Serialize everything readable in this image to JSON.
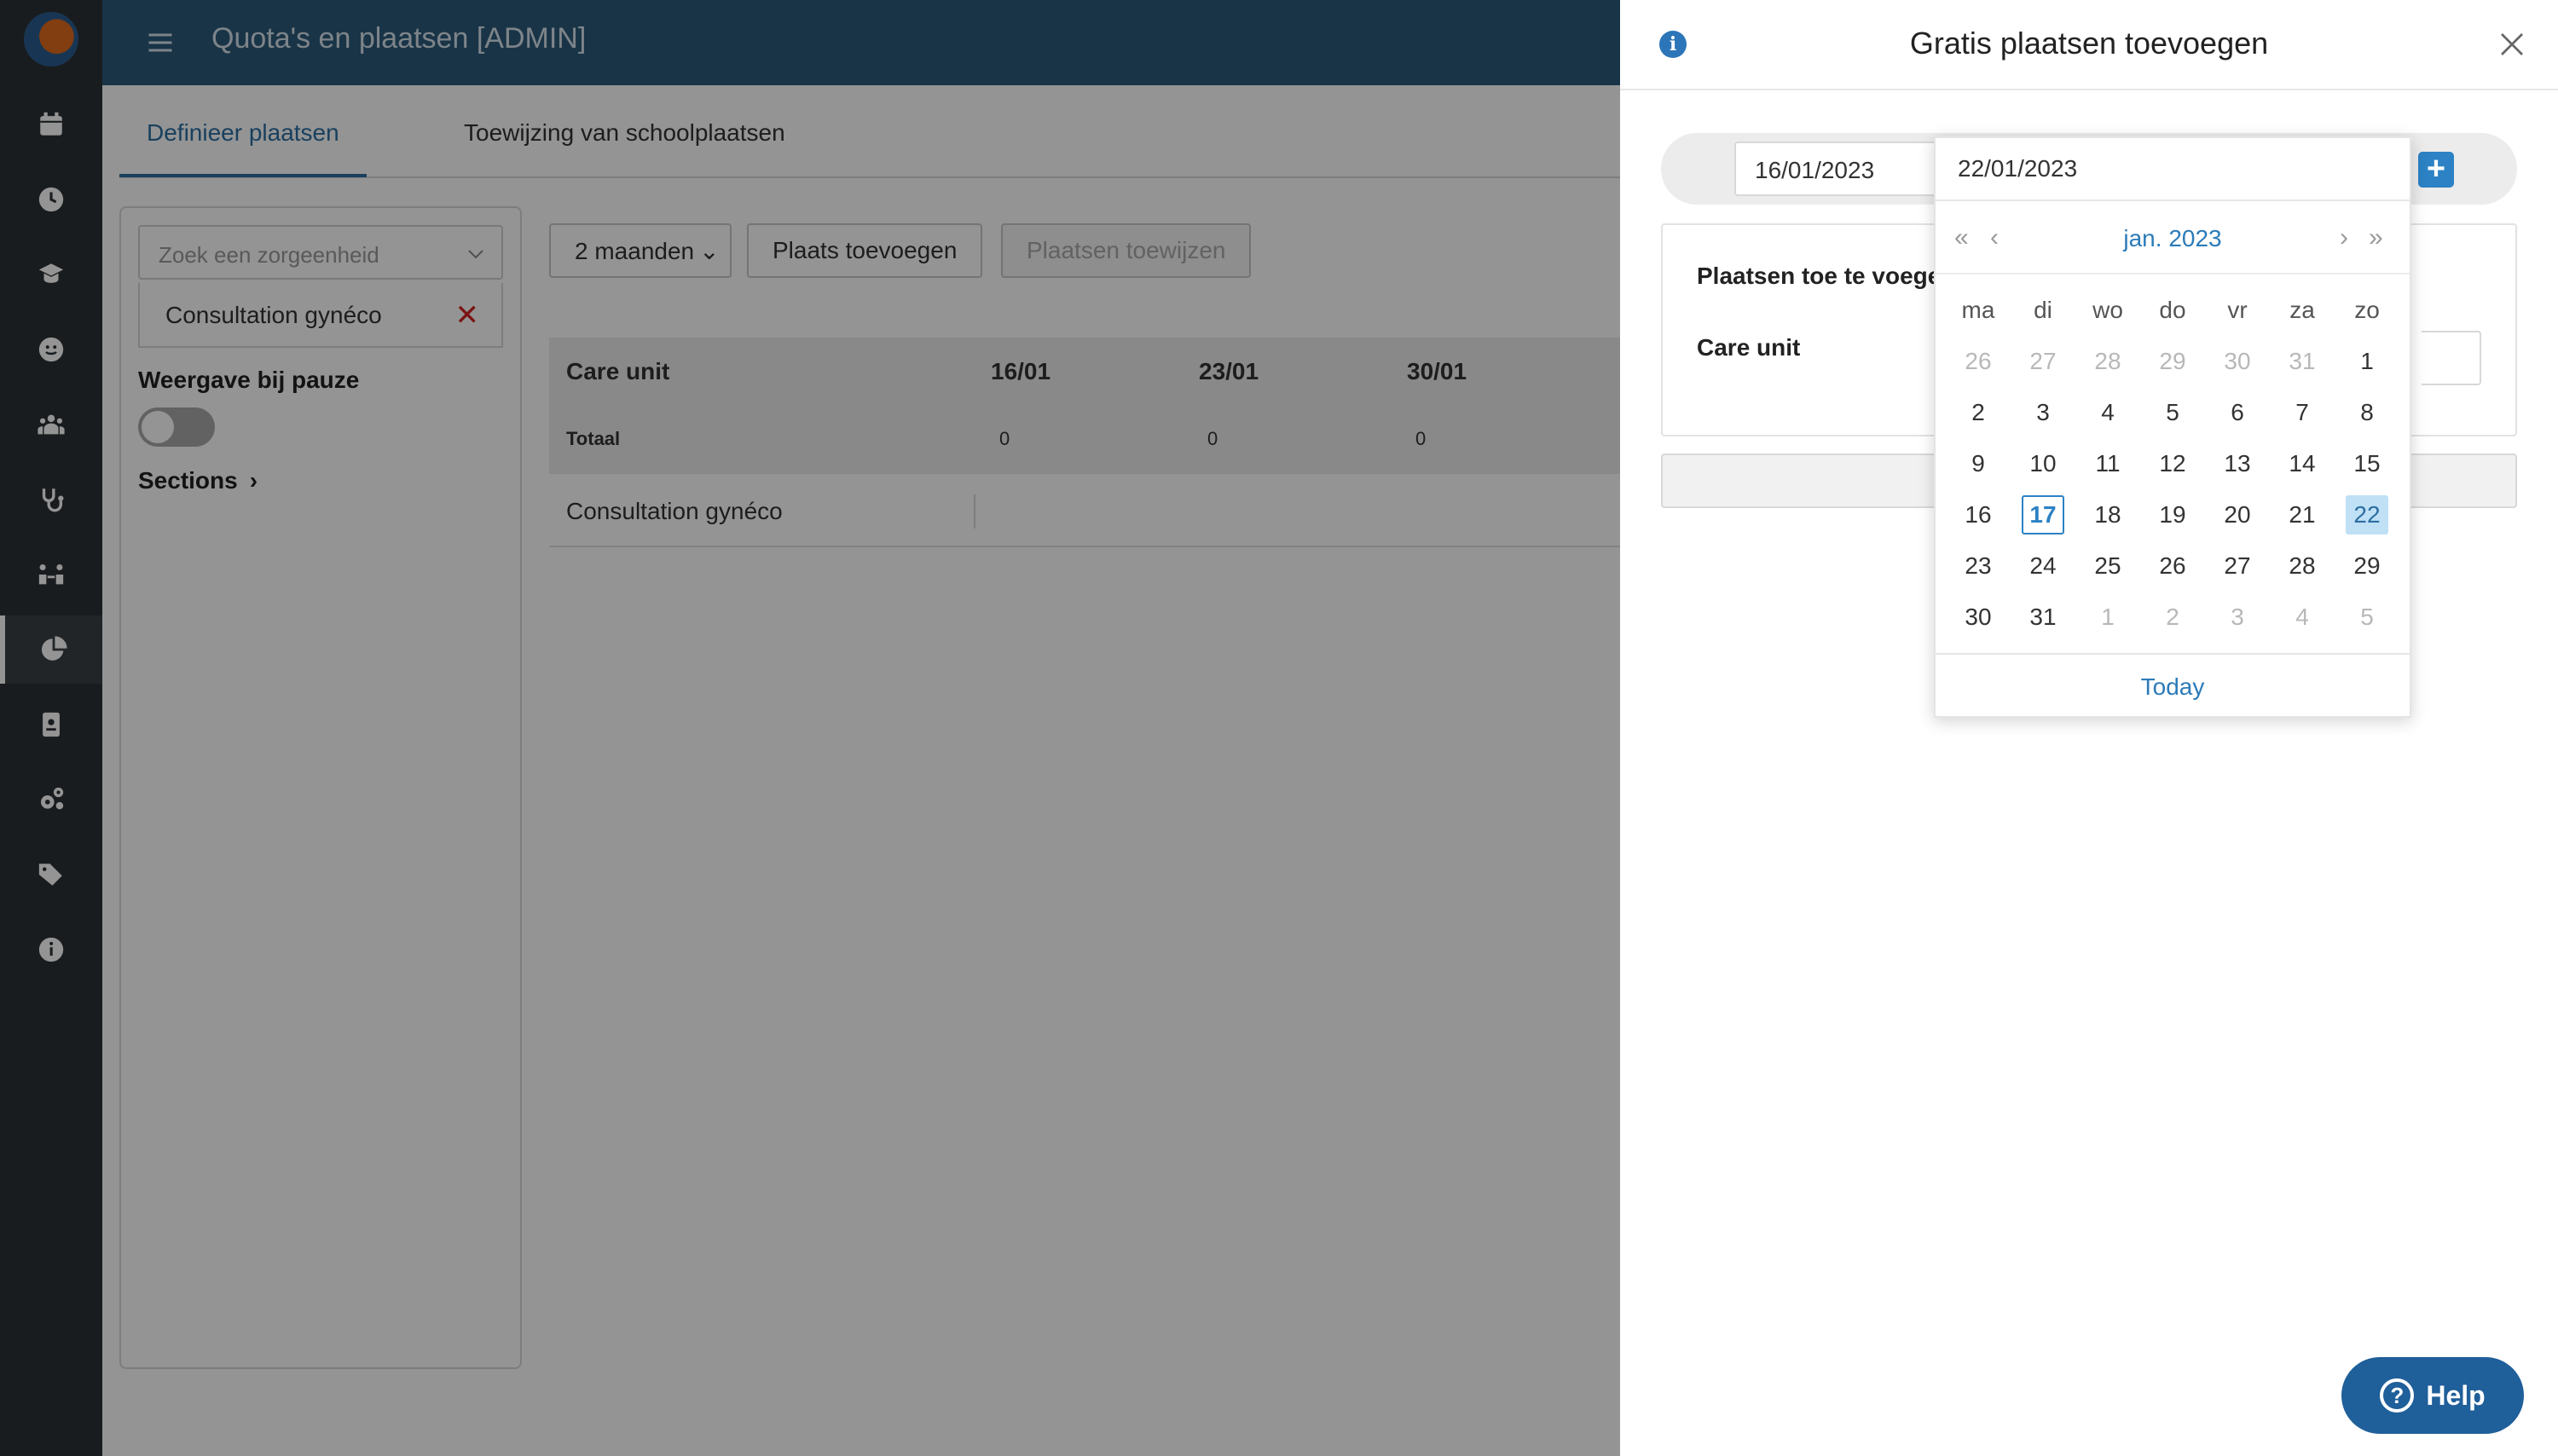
{
  "header": {
    "title": "Quota's en plaatsen [ADMIN]"
  },
  "tabs": [
    {
      "label": "Definieer plaatsen"
    },
    {
      "label": "Toewijzing van schoolplaatsen"
    }
  ],
  "sidebar_panel": {
    "search_placeholder": "Zoek een zorgeenheid",
    "selected_unit": "Consultation gynéco",
    "pause_label": "Weergave bij pauze",
    "sections_label": "Sections"
  },
  "toolbar": {
    "period": "2 maanden",
    "add_place": "Plaats toevoegen",
    "assign_places": "Plaatsen toewijzen"
  },
  "grid": {
    "header_label": "Care unit",
    "weeks": [
      "16/01",
      "23/01",
      "30/01"
    ],
    "total_label": "Totaal",
    "totals": [
      "0",
      "0",
      "0"
    ],
    "rows": [
      {
        "label": "Consultation gynéco"
      }
    ]
  },
  "drawer": {
    "title": "Gratis plaatsen toevoegen",
    "date_start": "16/01/2023",
    "places_label": "Plaatsen toe te voegen",
    "care_unit_label": "Care unit"
  },
  "calendar": {
    "input_value": "22/01/2023",
    "month_label": "jan. 2023",
    "weekdays": [
      "ma",
      "di",
      "wo",
      "do",
      "vr",
      "za",
      "zo"
    ],
    "weeks": [
      [
        "26",
        "27",
        "28",
        "29",
        "30",
        "31",
        "1"
      ],
      [
        "2",
        "3",
        "4",
        "5",
        "6",
        "7",
        "8"
      ],
      [
        "9",
        "10",
        "11",
        "12",
        "13",
        "14",
        "15"
      ],
      [
        "16",
        "17",
        "18",
        "19",
        "20",
        "21",
        "22"
      ],
      [
        "23",
        "24",
        "25",
        "26",
        "27",
        "28",
        "29"
      ],
      [
        "30",
        "31",
        "1",
        "2",
        "3",
        "4",
        "5"
      ]
    ],
    "today_label": "Today"
  },
  "help": {
    "label": "Help"
  },
  "colors": {
    "accent": "#2c82c4",
    "header": "#2c5a7b",
    "rail": "#2b3136",
    "selected_day": "#bfe0f5"
  }
}
